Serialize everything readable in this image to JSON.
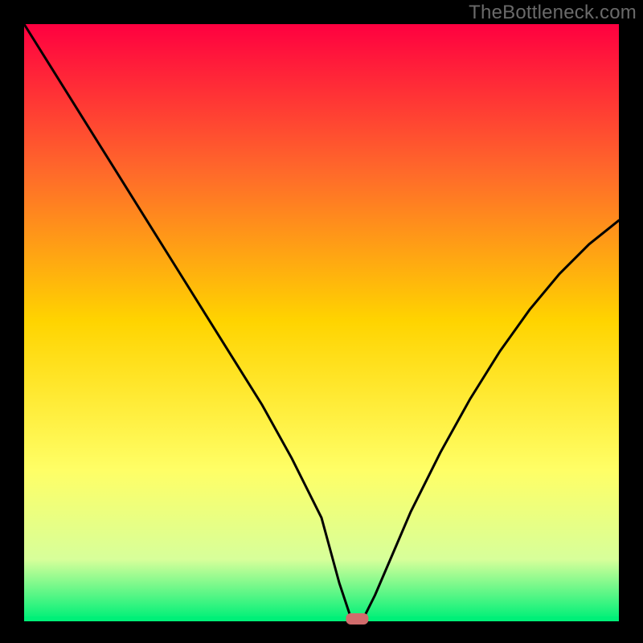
{
  "watermark": "TheBottleneck.com",
  "chart_data": {
    "type": "line",
    "title": "",
    "xlabel": "",
    "ylabel": "",
    "xlim": [
      0,
      100
    ],
    "ylim": [
      0,
      100
    ],
    "grid": false,
    "legend": false,
    "series": [
      {
        "name": "bottleneck-curve",
        "x": [
          0,
          5,
          10,
          15,
          20,
          25,
          30,
          35,
          40,
          45,
          50,
          53,
          55,
          57,
          59,
          62,
          65,
          70,
          75,
          80,
          85,
          90,
          95,
          100
        ],
        "values": [
          100,
          92,
          84,
          76,
          68,
          60,
          52,
          44,
          36,
          27,
          17,
          6,
          0,
          0,
          4,
          11,
          18,
          28,
          37,
          45,
          52,
          58,
          63,
          67
        ]
      }
    ],
    "marker": {
      "name": "optimal-point",
      "x": 56,
      "y": 0,
      "color": "#d16c6c"
    },
    "baseline": {
      "y": 0,
      "color": "#00f078"
    },
    "background_gradient": {
      "top": "#ff0040",
      "mid1": "#ff6a2a",
      "mid2": "#ffd400",
      "mid3": "#ffff66",
      "mid4": "#d7ff9a",
      "bottom": "#00f078"
    }
  }
}
